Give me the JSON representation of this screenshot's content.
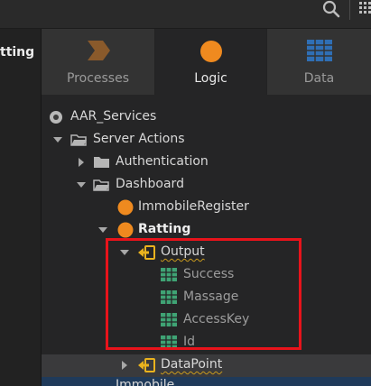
{
  "toolbar": {
    "search_icon": "search-icon",
    "grid_icon": "grid-icon"
  },
  "left_panel": {
    "label": "tting"
  },
  "tabs": [
    {
      "label": "Processes",
      "icon": "process-chevron-icon",
      "color": "#8a5a2b",
      "active": false
    },
    {
      "label": "Logic",
      "icon": "logic-circle-icon",
      "color": "#ef8a1f",
      "active": true
    },
    {
      "label": "Data",
      "icon": "data-grid-icon",
      "color": "#2f6fb5",
      "active": false
    }
  ],
  "tree": {
    "root": {
      "label": "AAR_Services"
    },
    "server_actions": {
      "label": "Server Actions"
    },
    "authentication": {
      "label": "Authentication"
    },
    "dashboard": {
      "label": "Dashboard"
    },
    "immobile_register": {
      "label": "ImmobileRegister"
    },
    "ratting": {
      "label": "Ratting"
    },
    "output": {
      "label": "Output",
      "items": [
        {
          "label": "Success"
        },
        {
          "label": "Massage"
        },
        {
          "label": "AccessKey"
        },
        {
          "label": "Id"
        }
      ]
    },
    "datapoint": {
      "label": "DataPoint"
    },
    "next_partial": {
      "label": "Immobile"
    }
  },
  "colors": {
    "accent_orange": "#ef8a1f",
    "structure_yellow": "#e9b21e",
    "attribute_green": "#3fa374",
    "highlight_red": "#e8131b"
  }
}
